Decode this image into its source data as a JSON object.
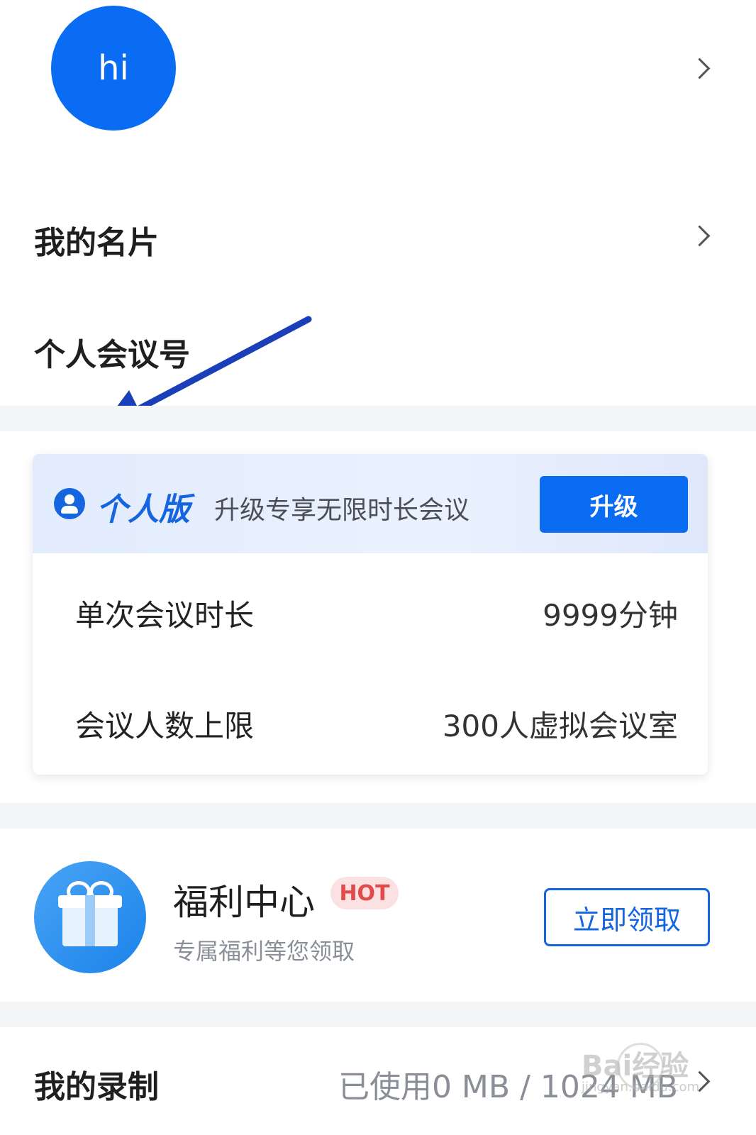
{
  "profile": {
    "avatar_text": "hi"
  },
  "business_card": {
    "label": "我的名片"
  },
  "personal_meeting_id": {
    "label": "个人会议号"
  },
  "plan": {
    "name": "个人版",
    "promo": "升级专享无限时长会议",
    "upgrade_label": "升级",
    "rows": [
      {
        "label": "单次会议时长",
        "value": "9999分钟"
      },
      {
        "label": "会议人数上限",
        "value": "300人虚拟会议室"
      }
    ]
  },
  "welfare": {
    "title": "福利中心",
    "badge": "HOT",
    "subtitle": "专属福利等您领取",
    "claim_label": "立即领取"
  },
  "recording": {
    "label": "我的录制",
    "usage": "已使用0 MB / 1024 MB"
  },
  "watermark": {
    "text": "Bai经验",
    "sub": "jingyan.baidu.com"
  },
  "colors": {
    "accent": "#0a6cf2",
    "hot": "#e24b4b",
    "annotation_arrow": "#1a3fb8"
  }
}
